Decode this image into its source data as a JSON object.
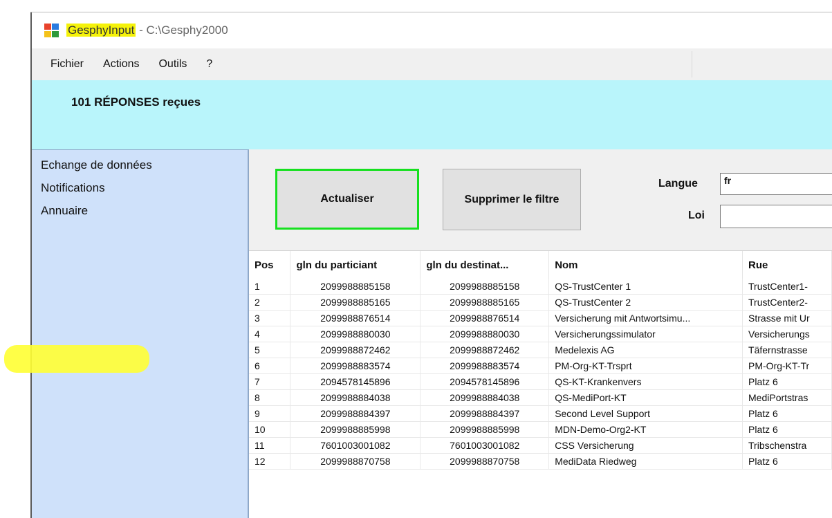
{
  "window": {
    "app_name": "GesphyInput",
    "title_suffix": " - C:\\Gesphy2000",
    "icon": "app-grid-icon"
  },
  "menu": {
    "items": [
      "Fichier",
      "Actions",
      "Outils",
      "?"
    ]
  },
  "banner": {
    "text": "101 RÉPONSES reçues",
    "color": "#b9f5fb"
  },
  "sidebar": {
    "items": [
      {
        "label": "Echange de données"
      },
      {
        "label": "Notifications"
      },
      {
        "label": "Annuaire",
        "selected": true
      }
    ]
  },
  "toolbar": {
    "refresh_label": "Actualiser",
    "clear_filter_label": "Supprimer le filtre",
    "langue_label": "Langue",
    "langue_value": "fr",
    "loi_label": "Loi",
    "loi_value": ""
  },
  "table": {
    "columns": [
      "Pos",
      "gln du particiant",
      "gln du destinat...",
      "Nom",
      "Rue"
    ],
    "rows": [
      [
        "1",
        "2099988885158",
        "2099988885158",
        "QS-TrustCenter 1",
        "TrustCenter1-"
      ],
      [
        "2",
        "2099988885165",
        "2099988885165",
        "QS-TrustCenter 2",
        "TrustCenter2-"
      ],
      [
        "3",
        "2099988876514",
        "2099988876514",
        "Versicherung mit Antwortsimu...",
        "Strasse mit Ur"
      ],
      [
        "4",
        "2099988880030",
        "2099988880030",
        "Versicherungssimulator",
        "Versicherungs"
      ],
      [
        "5",
        "2099988872462",
        "2099988872462",
        "Medelexis AG",
        "Täfernstrasse"
      ],
      [
        "6",
        "2099988883574",
        "2099988883574",
        "PM-Org-KT-Trsprt",
        "PM-Org-KT-Tr"
      ],
      [
        "7",
        "2094578145896",
        "2094578145896",
        "QS-KT-Krankenvers",
        "Platz 6"
      ],
      [
        "8",
        "2099988884038",
        "2099988884038",
        "QS-MediPort-KT",
        "MediPortstras"
      ],
      [
        "9",
        "2099988884397",
        "2099988884397",
        "Second Level Support",
        "Platz 6"
      ],
      [
        "10",
        "2099988885998",
        "2099988885998",
        "MDN-Demo-Org2-KT",
        "Platz 6"
      ],
      [
        "11",
        "7601003001082",
        "7601003001082",
        "CSS Versicherung",
        "Tribschenstra"
      ],
      [
        "12",
        "2099988870758",
        "2099988870758",
        "MediData Riedweg",
        "Platz 6"
      ]
    ]
  },
  "colors": {
    "highlight": "#ffff33",
    "refresh_border": "#16e01f",
    "sidebar_bg": "#cfe1fa"
  }
}
